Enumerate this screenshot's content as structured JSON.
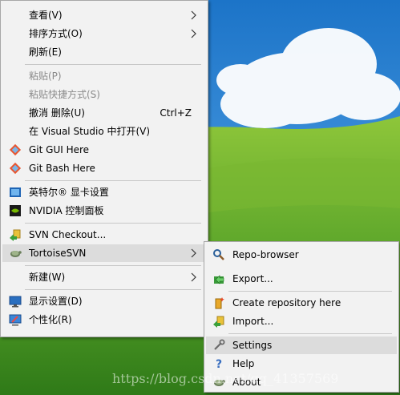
{
  "context_menu": {
    "items": [
      {
        "label": "查看(V)"
      },
      {
        "label": "排序方式(O)"
      },
      {
        "label": "刷新(E)"
      },
      {
        "label": "粘贴(P)"
      },
      {
        "label": "粘贴快捷方式(S)"
      },
      {
        "label": "撤消 删除(U)",
        "shortcut": "Ctrl+Z"
      },
      {
        "label": "在 Visual Studio 中打开(V)"
      },
      {
        "label": "Git GUI Here",
        "icon": "git-gui-icon"
      },
      {
        "label": "Git Bash Here",
        "icon": "git-bash-icon"
      },
      {
        "label": "英特尔® 显卡设置",
        "icon": "intel-graphics-icon"
      },
      {
        "label": "NVIDIA 控制面板",
        "icon": "nvidia-icon"
      },
      {
        "label": "SVN Checkout...",
        "icon": "svn-checkout-icon"
      },
      {
        "label": "TortoiseSVN",
        "icon": "tortoisesvn-icon"
      },
      {
        "label": "新建(W)"
      },
      {
        "label": "显示设置(D)",
        "icon": "display-settings-icon"
      },
      {
        "label": "个性化(R)",
        "icon": "personalize-icon"
      }
    ]
  },
  "tortoise_submenu": {
    "items": [
      {
        "label": "Repo-browser",
        "icon": "repo-browser-icon"
      },
      {
        "label": "Export...",
        "icon": "export-icon"
      },
      {
        "label": "Create repository here",
        "icon": "create-repository-icon"
      },
      {
        "label": "Import...",
        "icon": "import-icon"
      },
      {
        "label": "Settings",
        "icon": "settings-icon"
      },
      {
        "label": "Help",
        "icon": "help-icon"
      },
      {
        "label": "About",
        "icon": "about-icon"
      }
    ]
  },
  "watermark": "https://blog.csdn.net/qq_41357569",
  "colors": {
    "menu_bg": "#f2f2f2",
    "highlight": "#dcdcdc",
    "sky": "#3a8fd6",
    "grass": "#4c9a1f"
  }
}
